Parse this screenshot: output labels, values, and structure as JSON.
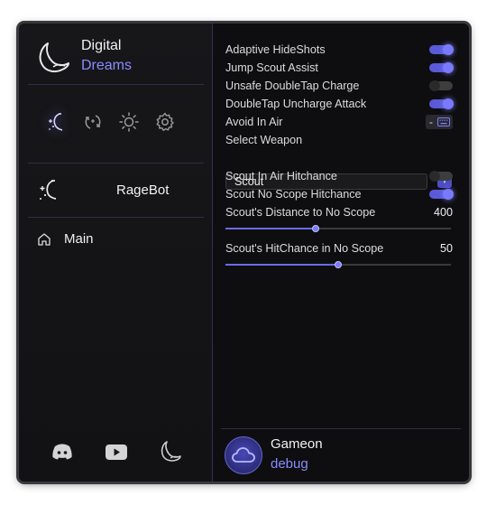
{
  "brand": {
    "line1": "Digital",
    "line2": "Dreams"
  },
  "tabs": [
    {
      "icon": "sparkle-moon-icon",
      "active": true
    },
    {
      "icon": "refresh-sparkle-icon",
      "active": false
    },
    {
      "icon": "sun-icon",
      "active": false
    },
    {
      "icon": "gear-icon",
      "active": false
    }
  ],
  "section": {
    "title": "RageBot",
    "icon": "sparkle-moon-icon"
  },
  "nav": {
    "main_label": "Main",
    "icon": "home-icon"
  },
  "footer_icons": [
    "discord-icon",
    "youtube-icon",
    "moon-logo-icon"
  ],
  "settings": {
    "adaptive_hideshots": {
      "label": "Adaptive HideShots",
      "on": true
    },
    "jump_scout_assist": {
      "label": "Jump Scout Assist",
      "on": true
    },
    "unsafe_doubletap_charge": {
      "label": "Unsafe DoubleTap Charge",
      "on": false
    },
    "doubletap_uncharge_attack": {
      "label": "DoubleTap Uncharge Attack",
      "on": true
    },
    "avoid_in_air": {
      "label": "Avoid In Air",
      "keybind": "-"
    },
    "select_weapon": {
      "label": "Select Weapon",
      "value": "Scout",
      "add_label": "+"
    },
    "scout_in_air_hitchance": {
      "label": "Scout In Air Hitchance",
      "on": false
    },
    "scout_no_scope_hitchance": {
      "label": "Scout No Scope Hitchance",
      "on": true
    },
    "scout_distance": {
      "label": "Scout's Distance to No Scope",
      "value": "400",
      "fraction": 0.4
    },
    "scout_hitchance": {
      "label": "Scout's HitChance in No Scope",
      "value": "50",
      "fraction": 0.5
    }
  },
  "user": {
    "name": "Gameon",
    "role": "debug"
  },
  "colors": {
    "accent": "#7a7aff",
    "background": "#0e0e10",
    "toggle_off": "#3d3d3d"
  }
}
